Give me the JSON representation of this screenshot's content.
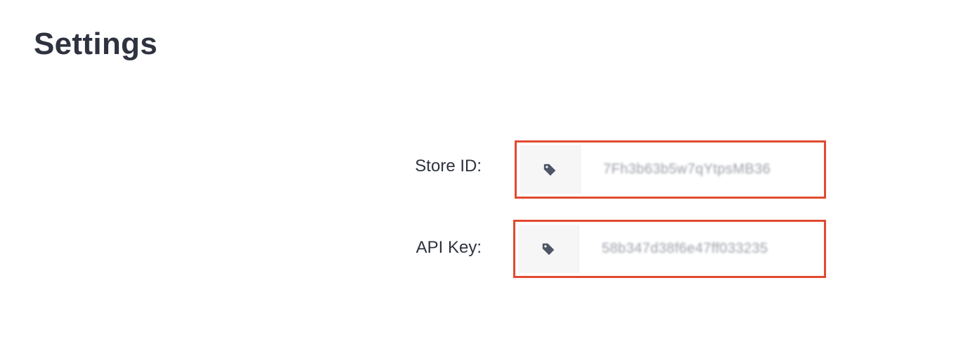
{
  "page": {
    "title": "Settings"
  },
  "fields": {
    "store_id": {
      "label": "Store ID:",
      "icon": "tag-icon",
      "value": "7Fh3b63b5w7qYtpsMB36"
    },
    "api_key": {
      "label": "API Key:",
      "icon": "tag-icon",
      "value": "58b347d38f6e47ff033235"
    }
  },
  "colors": {
    "highlight_border": "#e14a2f",
    "text": "#2f3340",
    "addon_bg": "#f6f6f6",
    "icon": "#4e5566"
  }
}
